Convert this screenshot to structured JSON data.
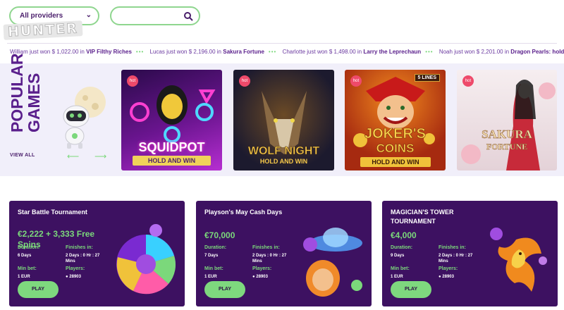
{
  "filters": {
    "provider_label": "All providers",
    "search_placeholder": ""
  },
  "brand": {
    "logo_text": "HUNTER"
  },
  "ticker": [
    {
      "player": "William",
      "text": "just won",
      "amount": "$ 1,022.00",
      "in": "in",
      "game": "VIP Filthy Riches"
    },
    {
      "player": "Lucas",
      "text": "just won",
      "amount": "$ 2,196.00",
      "in": "in",
      "game": "Sakura Fortune"
    },
    {
      "player": "Charlotte",
      "text": "just won",
      "amount": "$ 1,498.00",
      "in": "in",
      "game": "Larry the Leprechaun"
    },
    {
      "player": "Noah",
      "text": "just won",
      "amount": "$ 2,201.00",
      "in": "in",
      "game": "Dragon Pearls: hold and w"
    }
  ],
  "popular": {
    "title_line1": "POPULAR",
    "title_line2": "GAMES",
    "view_all": "VIEW ALL",
    "games": [
      {
        "name": "SQUIDPOT",
        "sub": "HOLD AND WIN",
        "badge": "hot",
        "colors": [
          "#2a0a4a",
          "#b62ed1"
        ]
      },
      {
        "name": "WOLF NIGHT",
        "sub": "HOLD AND WIN",
        "badge": "hot",
        "colors": [
          "#0d1b3d",
          "#4a2f1a"
        ]
      },
      {
        "name": "JOKER'S",
        "name2": "COINS",
        "sub": "HOLD AND WIN",
        "badge": "hot",
        "lines": "5 LINES",
        "colors": [
          "#d14a1e",
          "#7a1a0a"
        ]
      },
      {
        "name": "SAKURA",
        "name2": "FORTUNE",
        "badge": "hot",
        "colors": [
          "#f3e4e7",
          "#c92a3a"
        ]
      }
    ]
  },
  "tournaments": [
    {
      "title": "Star Battle Tournament",
      "prize": "€2,222 + 3,333 Free Spins",
      "duration_label": "Duration:",
      "duration": "6 Days",
      "finishes_label": "Finishes in:",
      "finishes": "2 Days : 0 Hr : 27 Mins",
      "minbet_label": "Min bet:",
      "minbet": "1 EUR",
      "players_label": "Players:",
      "players": "28903",
      "play": "PLAY"
    },
    {
      "title": "Playson's May Cash Days",
      "prize": "€70,000",
      "duration_label": "Duration:",
      "duration": "7 Days",
      "finishes_label": "Finishes in:",
      "finishes": "2 Days : 0 Hr : 27 Mins",
      "minbet_label": "Min bet:",
      "minbet": "1 EUR",
      "players_label": "Players:",
      "players": "28903",
      "play": "PLAY"
    },
    {
      "title": "MAGICIAN'S TOWER TOURNAMENT",
      "prize": "€4,000",
      "duration_label": "Duration:",
      "duration": "9 Days",
      "finishes_label": "Finishes in:",
      "finishes": "2 Days : 0 Hr : 27 Mins",
      "minbet_label": "Min bet:",
      "minbet": "1 EUR",
      "players_label": "Players:",
      "players": "28903",
      "play": "PLAY"
    }
  ],
  "colors": {
    "accent": "#7ed87e",
    "brand_purple": "#4a1e6b",
    "card_bg": "#3d1161"
  }
}
